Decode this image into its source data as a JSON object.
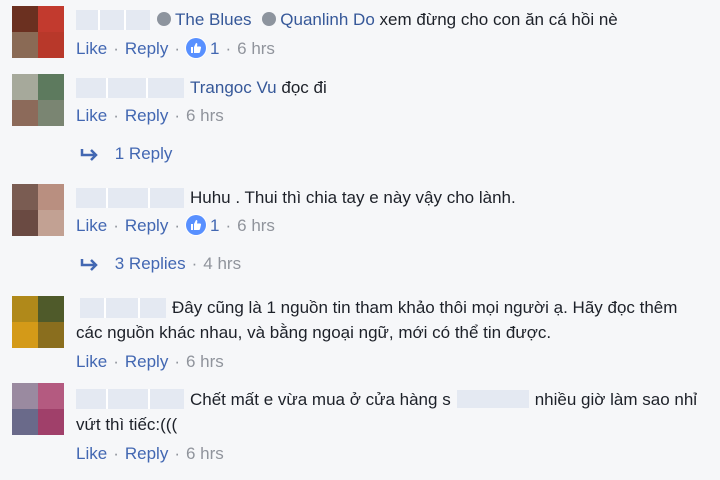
{
  "comments": [
    {
      "name": "The Blues",
      "mention": "Quanlinh Do",
      "text": "xem đừng cho con ăn cá hồi nè",
      "like": "Like",
      "reply": "Reply",
      "reactions": "1",
      "time": "6 hrs",
      "avatar_colors": [
        "#6b3020",
        "#c23a2e",
        "#8a6a55",
        "#b8382a"
      ]
    },
    {
      "mention": "Trangoc Vu",
      "text": "đọc đi",
      "like": "Like",
      "reply": "Reply",
      "time": "6 hrs",
      "avatar_colors": [
        "#a6a99b",
        "#5d7a5e",
        "#8c6a5a",
        "#7a8572"
      ]
    },
    {
      "replies_label": "1 Reply"
    },
    {
      "text": "Huhu . Thui thì chia tay e này vậy cho lành.",
      "like": "Like",
      "reply": "Reply",
      "reactions": "1",
      "time": "6 hrs",
      "avatar_colors": [
        "#7a5c52",
        "#b98f80",
        "#6a4a42",
        "#c2a193"
      ]
    },
    {
      "replies_label": "3 Replies",
      "replies_time": "4 hrs"
    },
    {
      "text_line1": "Đây cũng là 1 nguồn tin tham khảo thôi mọi người ạ. Hãy đọc thêm",
      "text_line2": "các nguồn khác nhau, và bằng ngoại ngữ, mới có thể tin được.",
      "like": "Like",
      "reply": "Reply",
      "time": "6 hrs",
      "avatar_colors": [
        "#b0891a",
        "#4f5a2a",
        "#d49a18",
        "#8a6e1e"
      ]
    },
    {
      "text_part1": "Chết mất e vừa mua ở cửa hàng s",
      "text_part2": "nhiều giờ làm sao nhỉ",
      "text_line2": "vứt thì tiếc:(((",
      "like": "Like",
      "reply": "Reply",
      "time": "6 hrs",
      "avatar_colors": [
        "#9a8aa0",
        "#b45a80",
        "#6a6a8a",
        "#a0406a"
      ]
    }
  ],
  "colors": {
    "link": "#4267b2",
    "name": "#365899",
    "meta": "#90949c",
    "like_badge": "#5890ff"
  }
}
